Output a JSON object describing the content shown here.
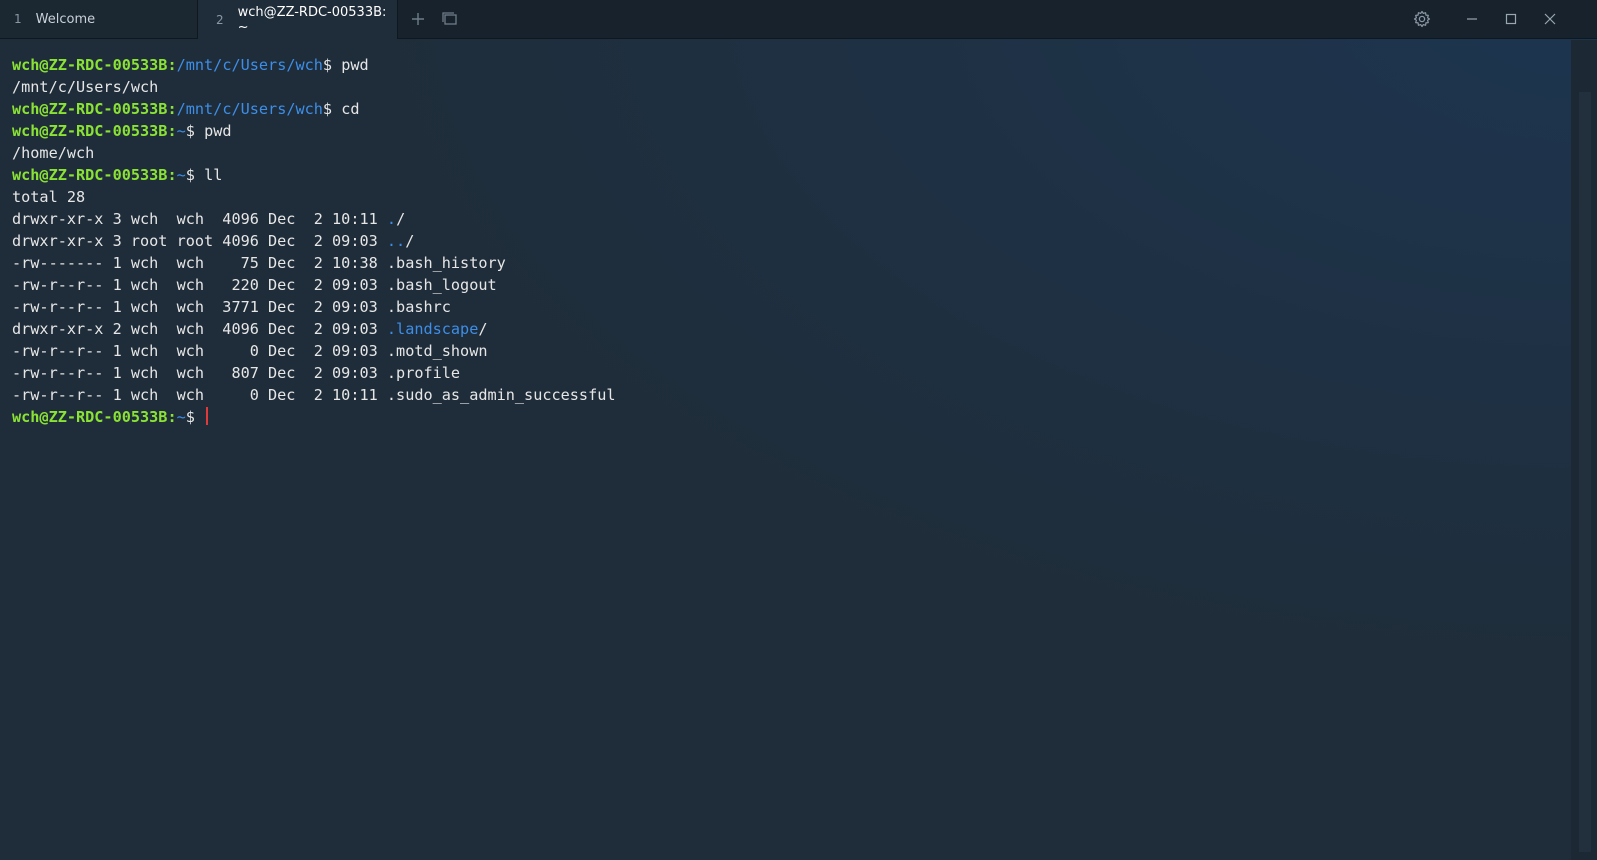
{
  "tabs": [
    {
      "number": "1",
      "label": "Welcome"
    },
    {
      "number": "2",
      "label": "wch@ZZ-RDC-00533B: ~"
    }
  ],
  "window": {
    "new_tab_icon": "plus-icon",
    "tab_list_icon": "window-list-icon",
    "settings_icon": "gear-icon",
    "minimize_icon": "minimize-icon",
    "maximize_icon": "maximize-icon",
    "close_icon": "close-icon"
  },
  "colors": {
    "prompt_user": "#8ae234",
    "prompt_path": "#3d8ee8",
    "cursor": "#e03a3a",
    "background": "#1f2d3a"
  },
  "terminal": {
    "prompt_user": "wch@ZZ-RDC-00533B",
    "lines": [
      {
        "type": "prompt",
        "path": "/mnt/c/Users/wch",
        "cmd": "pwd"
      },
      {
        "type": "out",
        "text": "/mnt/c/Users/wch"
      },
      {
        "type": "prompt",
        "path": "/mnt/c/Users/wch",
        "cmd": "cd"
      },
      {
        "type": "prompt",
        "path": "~",
        "cmd": "pwd"
      },
      {
        "type": "out",
        "text": "/home/wch"
      },
      {
        "type": "prompt",
        "path": "~",
        "cmd": "ll"
      },
      {
        "type": "out",
        "text": "total 28"
      },
      {
        "type": "ls",
        "meta": "drwxr-xr-x 3 wch  wch  4096 Dec  2 10:11",
        "name": "./",
        "dir": true
      },
      {
        "type": "ls",
        "meta": "drwxr-xr-x 3 root root 4096 Dec  2 09:03",
        "name": "../",
        "dir": true
      },
      {
        "type": "ls",
        "meta": "-rw------- 1 wch  wch    75 Dec  2 10:38",
        "name": ".bash_history",
        "dir": false
      },
      {
        "type": "ls",
        "meta": "-rw-r--r-- 1 wch  wch   220 Dec  2 09:03",
        "name": ".bash_logout",
        "dir": false
      },
      {
        "type": "ls",
        "meta": "-rw-r--r-- 1 wch  wch  3771 Dec  2 09:03",
        "name": ".bashrc",
        "dir": false
      },
      {
        "type": "ls",
        "meta": "drwxr-xr-x 2 wch  wch  4096 Dec  2 09:03",
        "name": ".landscape/",
        "dir": true
      },
      {
        "type": "ls",
        "meta": "-rw-r--r-- 1 wch  wch     0 Dec  2 09:03",
        "name": ".motd_shown",
        "dir": false
      },
      {
        "type": "ls",
        "meta": "-rw-r--r-- 1 wch  wch   807 Dec  2 09:03",
        "name": ".profile",
        "dir": false
      },
      {
        "type": "ls",
        "meta": "-rw-r--r-- 1 wch  wch     0 Dec  2 10:11",
        "name": ".sudo_as_admin_successful",
        "dir": false
      },
      {
        "type": "prompt",
        "path": "~",
        "cmd": "",
        "cursor": true
      }
    ]
  }
}
